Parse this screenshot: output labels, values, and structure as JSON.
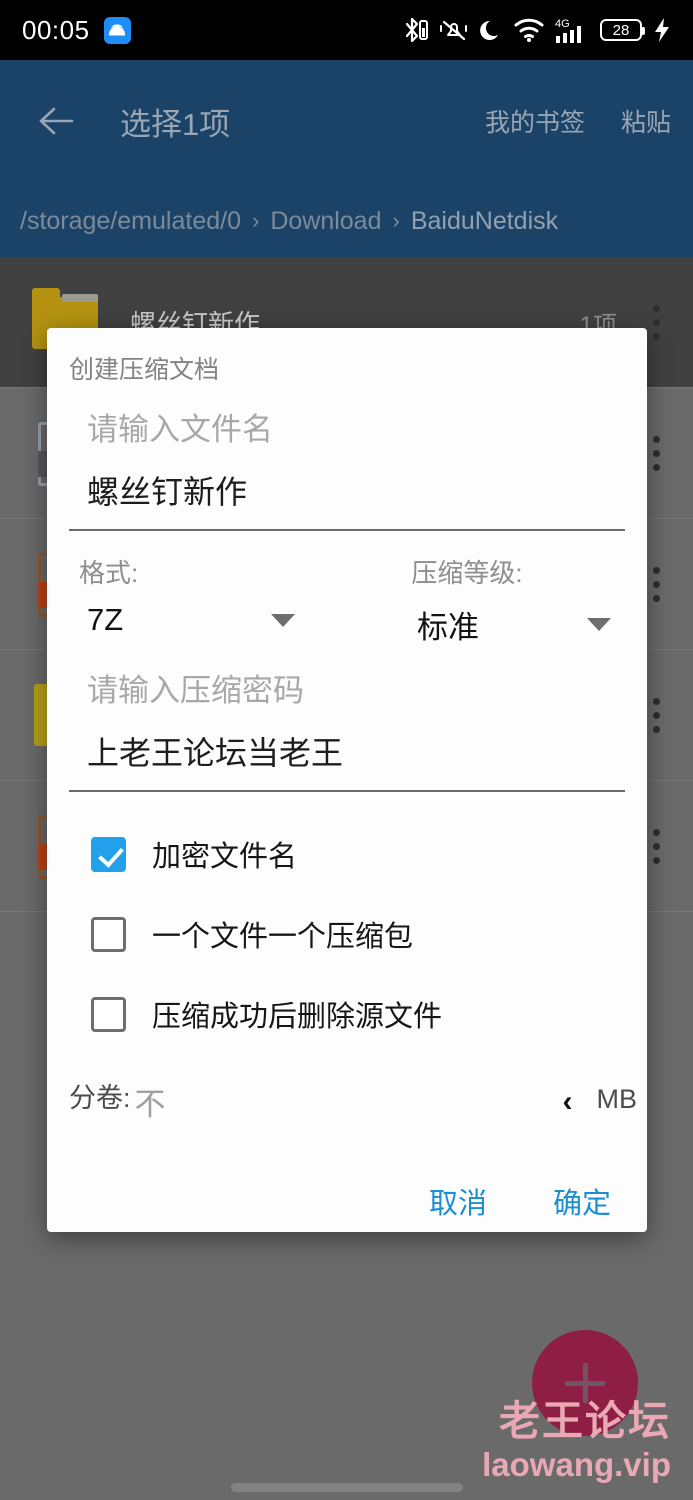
{
  "statusbar": {
    "time": "00:05",
    "app_icon": "android-icon",
    "icons": [
      "bluetooth-icon",
      "vibrate-off-icon",
      "do-not-disturb-moon-icon",
      "wifi-icon",
      "signal-4g-icon"
    ],
    "network_label": "4G",
    "battery_level": "28",
    "charging_icon": "charging-bolt-icon"
  },
  "header": {
    "back_icon": "back-arrow-icon",
    "title": "选择1项",
    "actions": [
      {
        "label": "我的书签"
      },
      {
        "label": "粘贴"
      }
    ],
    "breadcrumb": {
      "separator": "›",
      "segments": [
        "/storage/emulated/0",
        "Download",
        "BaiduNetdisk"
      ]
    }
  },
  "file_list": {
    "overflow_icon": "more-vertical-icon",
    "rows": [
      {
        "icon": "folder-icon",
        "name": "螺丝钉新作",
        "meta": "1项",
        "selected": true
      },
      {
        "icon": "file-gray-icon",
        "name": "",
        "meta": "",
        "selected": false
      },
      {
        "icon": "file-red-icon",
        "name": "",
        "meta": "",
        "selected": false
      },
      {
        "icon": "image-yellow-icon",
        "name": "",
        "meta": "",
        "selected": false
      },
      {
        "icon": "file-red-icon",
        "name": "",
        "meta": "",
        "selected": false
      }
    ]
  },
  "dialog": {
    "title": "创建压缩文档",
    "filename": {
      "placeholder": "请输入文件名",
      "value": "螺丝钉新作"
    },
    "format": {
      "label": "格式:",
      "value": "7Z",
      "caret_icon": "chevron-down-icon"
    },
    "level": {
      "label": "压缩等级:",
      "value": "标准",
      "caret_icon": "chevron-down-icon"
    },
    "password": {
      "placeholder": "请输入压缩密码",
      "value": "上老王论坛当老王"
    },
    "checkboxes": [
      {
        "label": "加密文件名",
        "checked": true
      },
      {
        "label": "一个文件一个压缩包",
        "checked": false
      },
      {
        "label": "压缩成功后删除源文件",
        "checked": false
      }
    ],
    "split": {
      "label": "分卷:",
      "placeholder": "不",
      "value": "",
      "stepper_icon": "chevron-left-icon",
      "unit": "MB"
    },
    "buttons": {
      "cancel": "取消",
      "confirm": "确定"
    }
  },
  "fab": {
    "icon": "plus-icon",
    "color": "#8e1e44"
  },
  "watermark": {
    "cn": "老王论坛",
    "en": "laowang.vip",
    "color": "#eaa8b4"
  },
  "colors": {
    "header_blue": "#1b4367",
    "checkbox_blue": "#22a0ec",
    "button_blue": "#1c8fd4",
    "scrim": "#6a6a6a"
  }
}
